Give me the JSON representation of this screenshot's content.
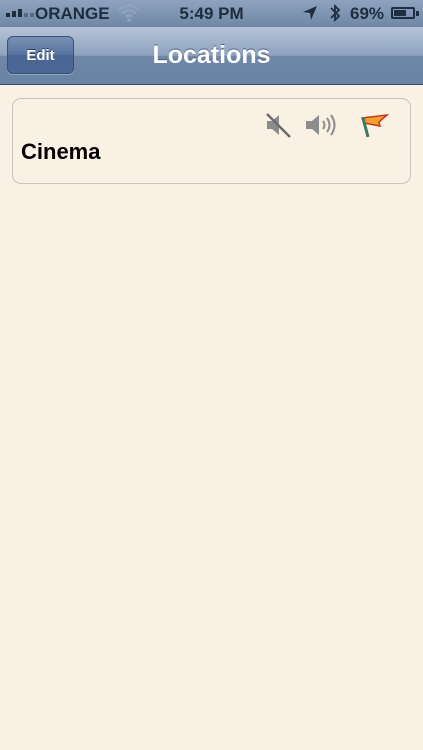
{
  "status_bar": {
    "carrier": "ORANGE",
    "time": "5:49 PM",
    "battery_percent_text": "69%",
    "battery_level": 0.69
  },
  "nav": {
    "edit_label": "Edit",
    "title": "Locations"
  },
  "locations": [
    {
      "name": "Cinema",
      "icons": [
        "mute-icon",
        "speaker-icon",
        "flag-icon"
      ]
    }
  ],
  "colors": {
    "background": "#f9f1e4",
    "nav_bar": "#6f87a8",
    "flag": "#f0a22a"
  }
}
